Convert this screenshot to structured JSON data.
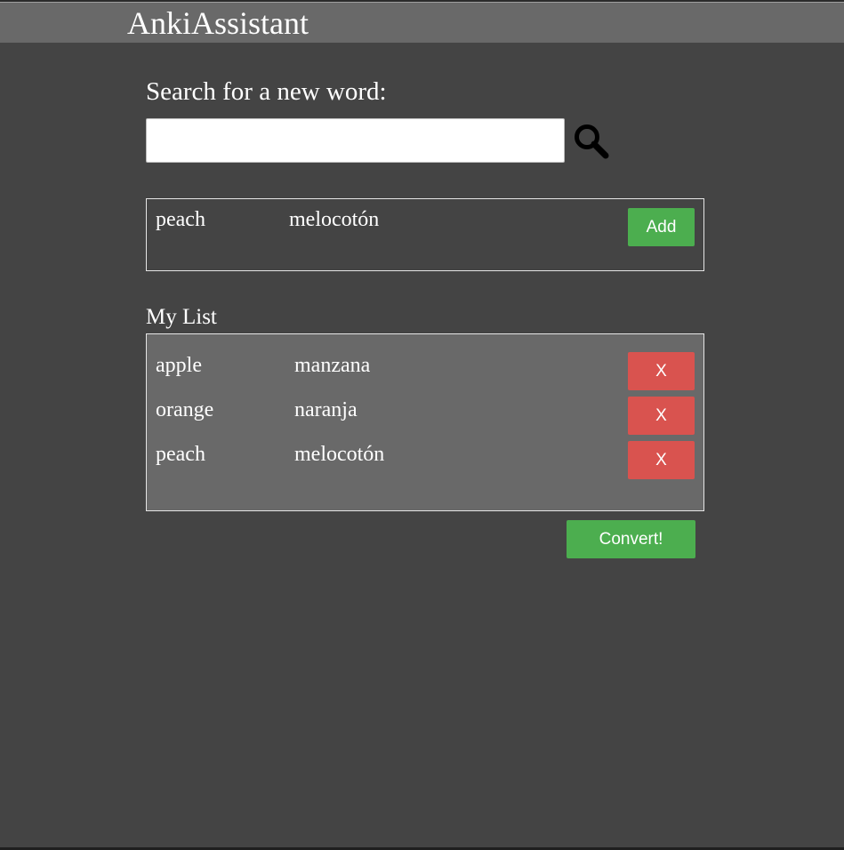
{
  "app": {
    "title": "AnkiAssistant"
  },
  "search": {
    "heading": "Search for a new word:",
    "value": "",
    "placeholder": "",
    "icon": "search-icon"
  },
  "result": {
    "word": "peach",
    "translation": "melocotón",
    "add_label": "Add"
  },
  "my_list": {
    "heading": "My List",
    "items": [
      {
        "word": "apple",
        "translation": "manzana",
        "remove_label": "X"
      },
      {
        "word": "orange",
        "translation": "naranja",
        "remove_label": "X"
      },
      {
        "word": "peach",
        "translation": "melocotón",
        "remove_label": "X"
      }
    ]
  },
  "convert_label": "Convert!",
  "colors": {
    "background": "#444444",
    "header": "#696969",
    "list_background": "#696969",
    "green": "#4cae4f",
    "red": "#d9534f"
  }
}
